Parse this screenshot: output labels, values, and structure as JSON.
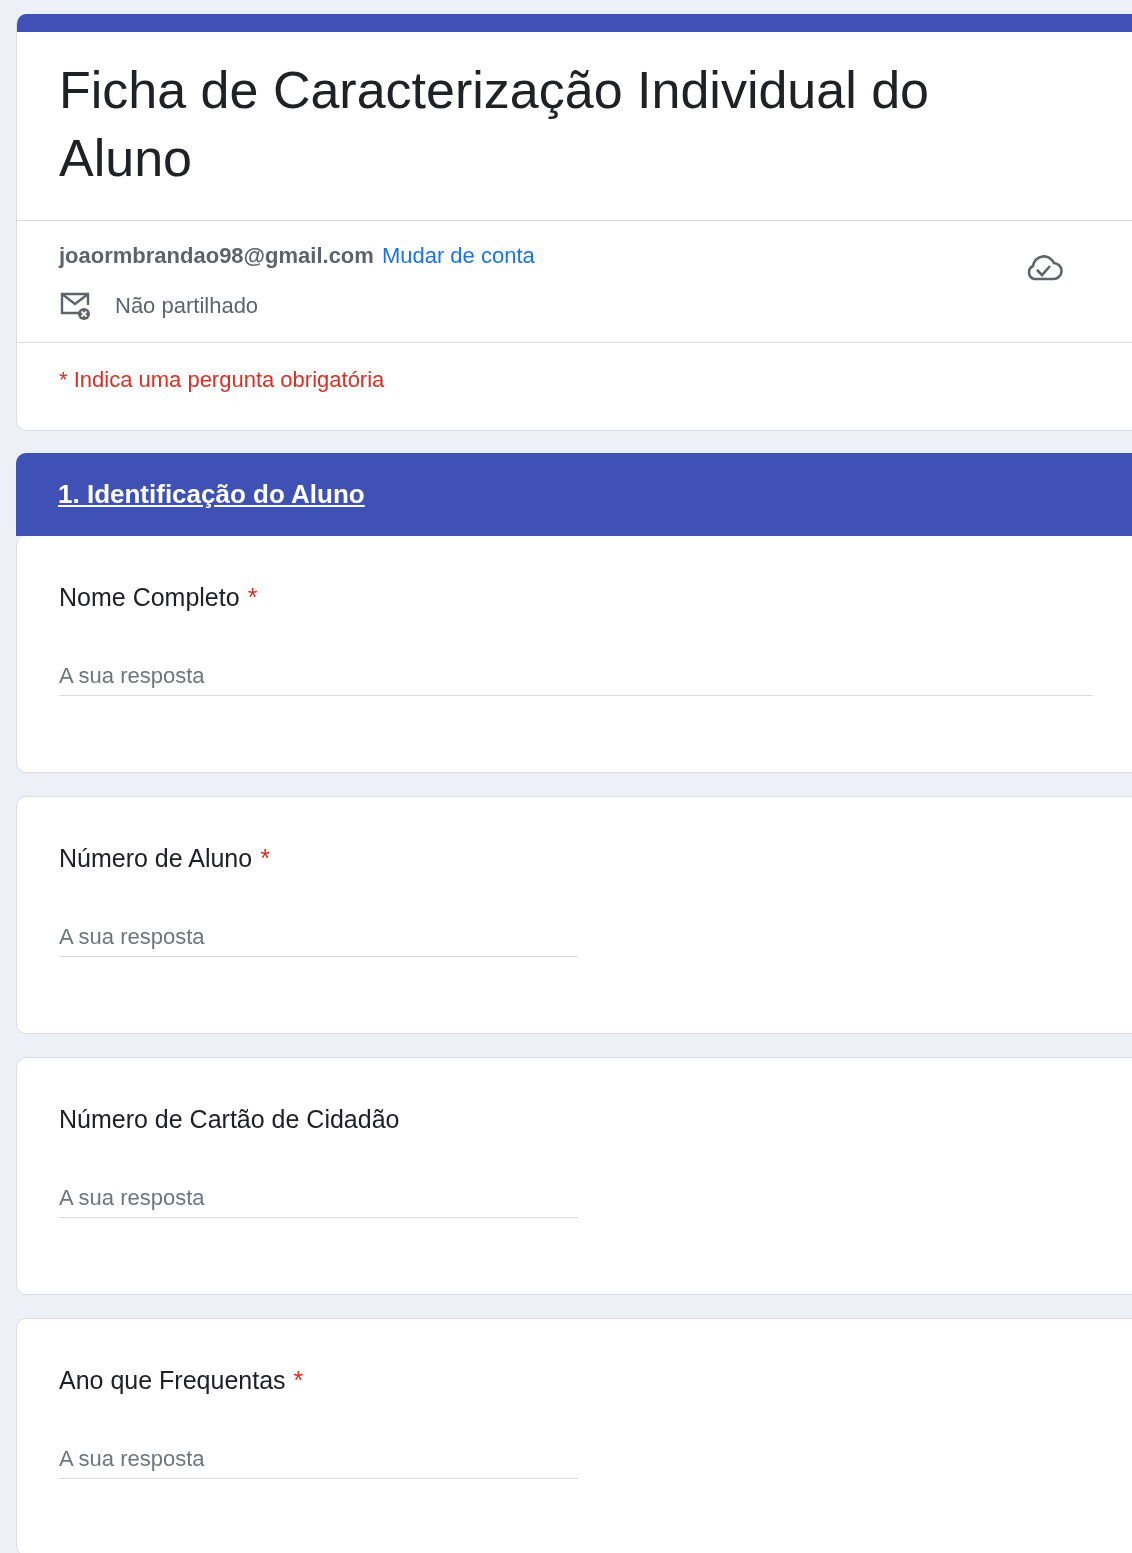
{
  "form": {
    "title": "Ficha de Caracterização Individual do Aluno",
    "account": "joaormbrandao98@gmail.com",
    "switch_account": "Mudar de conta",
    "sharing": "Não partilhado",
    "required_note": "* Indica uma pergunta obrigatória"
  },
  "section": {
    "title": "1. Identificação do Aluno"
  },
  "questions": [
    {
      "label": "Nome Completo",
      "required": true,
      "required_mark": "*",
      "placeholder": "A sua resposta",
      "kind": "full"
    },
    {
      "label": "Número de Aluno",
      "required": true,
      "required_mark": "*",
      "placeholder": "A sua resposta",
      "kind": "half"
    },
    {
      "label": "Número de Cartão de Cidadão",
      "required": false,
      "placeholder": "A sua resposta",
      "kind": "half"
    },
    {
      "label": "Ano que Frequentas",
      "required": true,
      "required_mark": "*",
      "placeholder": "A sua resposta",
      "kind": "half"
    }
  ]
}
